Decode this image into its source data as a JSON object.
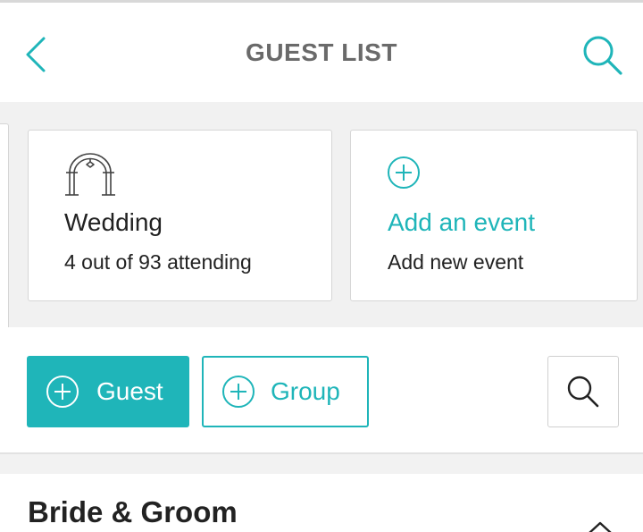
{
  "header": {
    "title": "GUEST LIST",
    "back_icon": "chevron-left-icon",
    "search_icon": "search-icon"
  },
  "events": [
    {
      "title": "Wedding",
      "subtitle": "4 out of 93 attending",
      "icon": "wedding-arch-icon"
    },
    {
      "title": "Add an event",
      "subtitle": "Add new event",
      "icon": "plus-circle-icon"
    }
  ],
  "actions": {
    "guest_label": "Guest",
    "group_label": "Group",
    "search_icon": "search-icon"
  },
  "section": {
    "title": "Bride & Groom",
    "toggle_icon": "chevron-up-icon"
  },
  "colors": {
    "accent": "#1fb5b9",
    "title_gray": "#6a6a6a",
    "text": "#222222",
    "background": "#f1f1f1",
    "border": "#d6d6d6"
  }
}
